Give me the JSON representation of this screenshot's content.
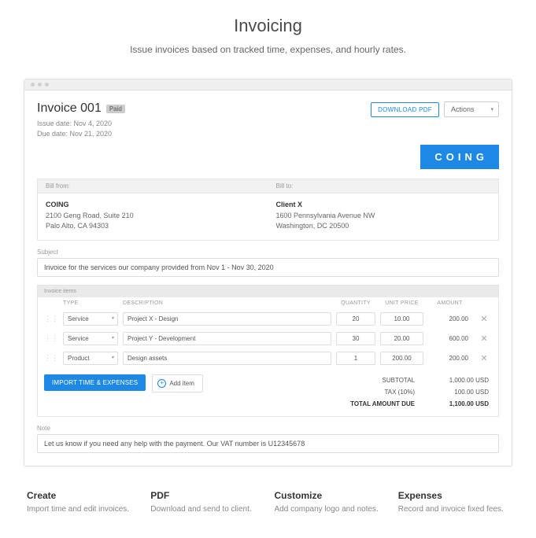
{
  "hero": {
    "title": "Invoicing",
    "subtitle": "Issue invoices based on tracked time, expenses, and hourly rates."
  },
  "invoice": {
    "title": "Invoice 001",
    "badge": "Paid",
    "issue_date_label": "Issue date: Nov 4, 2020",
    "due_date_label": "Due date: Nov 21, 2020",
    "download_label": "DOWNLOAD PDF",
    "actions_label": "Actions",
    "brand": "COING",
    "bill_from_label": "Bill from:",
    "bill_to_label": "Bill to:",
    "from": {
      "name": "COING",
      "line1": "2100 Geng Road, Suite 210",
      "line2": "Palo Alto, CA 94303"
    },
    "to": {
      "name": "Client X",
      "line1": "1600 Pennsylvania Avenue NW",
      "line2": "Washington, DC 20500"
    },
    "subject_label": "Subject",
    "subject_value": "Invoice for the services our company provided from Nov 1 - Nov 30, 2020",
    "items_label": "Invoice items",
    "headers": {
      "type": "TYPE",
      "desc": "DESCRIPTION",
      "qty": "QUANTITY",
      "price": "UNIT PRICE",
      "amount": "AMOUNT"
    },
    "items": [
      {
        "type": "Service",
        "desc": "Project X - Design",
        "qty": "20",
        "price": "10.00",
        "amount": "200.00"
      },
      {
        "type": "Service",
        "desc": "Project Y - Development",
        "qty": "30",
        "price": "20.00",
        "amount": "600.00"
      },
      {
        "type": "Product",
        "desc": "Design assets",
        "qty": "1",
        "price": "200.00",
        "amount": "200.00"
      }
    ],
    "import_label": "IMPORT TIME & EXPENSES",
    "add_item_label": "Add item",
    "subtotal_label": "SUBTOTAL",
    "subtotal_value": "1,000.00 USD",
    "tax_label": "TAX  (10%)",
    "tax_value": "100.00 USD",
    "total_label": "TOTAL AMOUNT DUE",
    "total_value": "1,100.00 USD",
    "note_label": "Note",
    "note_value": "Let us know if you need any help with the payment. Our VAT number is U12345678"
  },
  "features": [
    {
      "title": "Create",
      "desc": "Import time and edit invoices."
    },
    {
      "title": "PDF",
      "desc": "Download and send to client."
    },
    {
      "title": "Customize",
      "desc": "Add company logo and notes."
    },
    {
      "title": "Expenses",
      "desc": "Record and invoice fixed fees."
    }
  ]
}
